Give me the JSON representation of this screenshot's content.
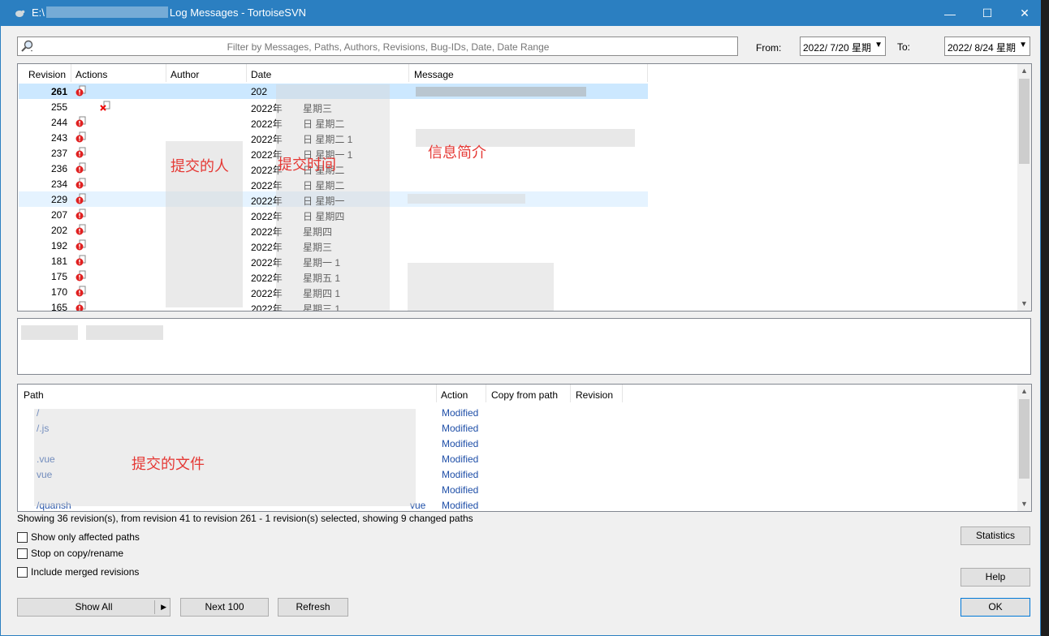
{
  "window": {
    "title_prefix": "E:\\",
    "title_suffix": "Log Messages - TortoiseSVN",
    "min_glyph": "—",
    "max_glyph": "☐",
    "close_glyph": "✕"
  },
  "filter": {
    "placeholder": "Filter by Messages, Paths, Authors, Revisions, Bug-IDs, Date, Date Range",
    "from_label": "From:",
    "from_value": "2022/  7/20 星期",
    "to_label": "To:",
    "to_value": "2022/  8/24 星期"
  },
  "log": {
    "columns": [
      "Revision",
      "Actions",
      "Author",
      "Date",
      "Message"
    ],
    "rows": [
      {
        "rev": "261",
        "date": "202",
        "bold": true
      },
      {
        "rev": "255",
        "date": "2022年",
        "weekday": "星期三"
      },
      {
        "rev": "244",
        "date": "2022年",
        "weekday": "日 星期二"
      },
      {
        "rev": "243",
        "date": "2022年",
        "weekday": "日 星期二 1"
      },
      {
        "rev": "237",
        "date": "2022年",
        "weekday": "日 星期一 1"
      },
      {
        "rev": "236",
        "date": "2022年",
        "weekday": "日 星期二"
      },
      {
        "rev": "234",
        "date": "2022年",
        "weekday": "日 星期二"
      },
      {
        "rev": "229",
        "date": "2022年",
        "weekday": "日 星期一"
      },
      {
        "rev": "207",
        "date": "2022年",
        "weekday": "日 星期四"
      },
      {
        "rev": "202",
        "date": "2022年",
        "weekday": "星期四"
      },
      {
        "rev": "192",
        "date": "2022年",
        "weekday": "星期三"
      },
      {
        "rev": "181",
        "date": "2022年",
        "weekday": "星期一 1"
      },
      {
        "rev": "175",
        "date": "2022年",
        "weekday": "星期五 1"
      },
      {
        "rev": "170",
        "date": "2022年",
        "weekday": "星期四 1"
      },
      {
        "rev": "165",
        "date": "2022年",
        "weekday": "星期三 1"
      }
    ],
    "annotations": {
      "author": "提交的人",
      "date": "提交时间",
      "message": "信息简介"
    }
  },
  "paths": {
    "columns": [
      "Path",
      "Action",
      "Copy from path",
      "Revision"
    ],
    "rows": [
      {
        "path": "/",
        "action": "Modified"
      },
      {
        "path": "/.js",
        "action": "Modified"
      },
      {
        "path": "",
        "action": "Modified"
      },
      {
        "path": ".vue",
        "action": "Modified"
      },
      {
        "path": "vue",
        "action": "Modified"
      },
      {
        "path": "",
        "action": "Modified"
      },
      {
        "path": "/quansh",
        "action": "Modified",
        "suffix": "vue"
      }
    ],
    "annotation": "提交的文件"
  },
  "status_text": "Showing 36 revision(s), from revision 41 to revision 261 - 1 revision(s) selected, showing 9 changed paths",
  "options": {
    "show_affected": "Show only affected paths",
    "stop_copy": "Stop on copy/rename",
    "include_merged": "Include merged revisions"
  },
  "buttons": {
    "statistics": "Statistics",
    "help": "Help",
    "show_all": "Show All",
    "next_100": "Next 100",
    "refresh": "Refresh",
    "ok": "OK"
  }
}
